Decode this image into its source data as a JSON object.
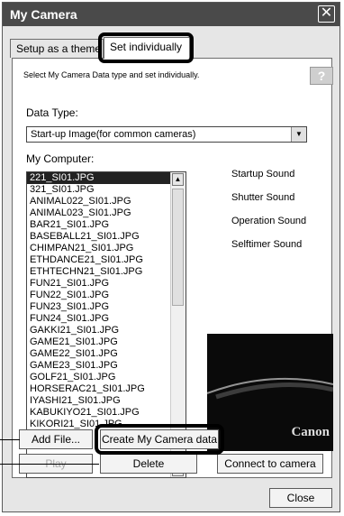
{
  "window": {
    "title": "My Camera",
    "close_glyph": "✕"
  },
  "tabs": [
    {
      "label": "Setup as a theme"
    },
    {
      "label": "Set individually"
    }
  ],
  "instruction": "Select My Camera Data type and set individually.",
  "help_label": "?",
  "data_type": {
    "label": "Data Type:",
    "selected": "Start-up Image(for common cameras)"
  },
  "my_computer": {
    "label": "My Computer:"
  },
  "files": [
    "221_SI01.JPG",
    "321_SI01.JPG",
    "ANIMAL022_SI01.JPG",
    "ANIMAL023_SI01.JPG",
    "BAR21_SI01.JPG",
    "BASEBALL21_SI01.JPG",
    "CHIMPAN21_SI01.JPG",
    "ETHDANCE21_SI01.JPG",
    "ETHTECHN21_SI01.JPG",
    "FUN21_SI01.JPG",
    "FUN22_SI01.JPG",
    "FUN23_SI01.JPG",
    "FUN24_SI01.JPG",
    "GAKKI21_SI01.JPG",
    "GAME21_SI01.JPG",
    "GAME22_SI01.JPG",
    "GAME23_SI01.JPG",
    "GOLF21_SI01.JPG",
    "HORSERAC21_SI01.JPG",
    "IYASHI21_SI01.JPG",
    "KABUKIYO21_SI01.JPG",
    "KIKORI21_SI01.JPG"
  ],
  "sounds": [
    "Startup Sound",
    "Shutter Sound",
    "Operation Sound",
    "Selftimer Sound"
  ],
  "preview": {
    "brand": "Canon"
  },
  "buttons": {
    "add_file": "Add File...",
    "create": "Create My Camera data",
    "play": "Play",
    "delete": "Delete",
    "connect": "Connect to camera",
    "close": "Close"
  }
}
